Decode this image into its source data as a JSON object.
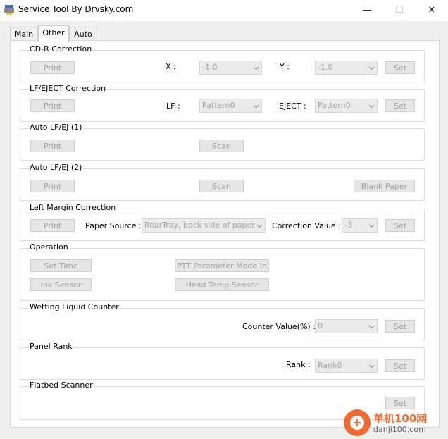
{
  "window": {
    "title": "Service Tool By Drvsky.com",
    "minimize_glyph": "—",
    "maximize_glyph": "☐",
    "close_glyph": "✕"
  },
  "tabs": [
    {
      "label": "Main",
      "active": false
    },
    {
      "label": "Other",
      "active": true
    },
    {
      "label": "Auto",
      "active": false
    }
  ],
  "cdr": {
    "title": "CD-R Correction",
    "print": "Print",
    "x_label": "X :",
    "x_value": "-1.0",
    "y_label": "Y :",
    "y_value": "-1.0",
    "set": "Set"
  },
  "lfeject": {
    "title": "LF/EJECT Correction",
    "print": "Print",
    "lf_label": "LF :",
    "lf_value": "Pattern0",
    "eject_label": "EJECT :",
    "eject_value": "Pattern0",
    "set": "Set"
  },
  "autolf1": {
    "title": "Auto LF/EJ (1)",
    "print": "Print",
    "scan": "Scan"
  },
  "autolf2": {
    "title": "Auto LF/EJ (2)",
    "print": "Print",
    "scan": "Scan",
    "blank": "Blank Paper"
  },
  "leftmargin": {
    "title": "Left Margin Correction",
    "print": "Print",
    "source_label": "Paper Source :",
    "source_value": "RearTray, back side of paper",
    "corr_label": "Correction Value :",
    "corr_value": "-3",
    "set": "Set"
  },
  "operation": {
    "title": "Operation",
    "set_time": "Set Time",
    "ptt": "PTT Parameter Mode In",
    "ink": "Ink Sensor",
    "headtemp": "Head Temp Sensor"
  },
  "wetting": {
    "title": "Wetting Liquid Counter",
    "counter_label": "Counter Value(%) :",
    "counter_value": "0",
    "set": "Set"
  },
  "panelrank": {
    "title": "Panel Rank",
    "rank_label": "Rank :",
    "rank_value": "Rank0",
    "set": "Set"
  },
  "flatbed": {
    "title": "Flatbed Scanner",
    "set": "Set"
  },
  "watermark": {
    "line1": "单机100网",
    "line2": "danji100.com",
    "glyph": "+"
  },
  "colors": {
    "disabled_text": "#a0a0a0",
    "watermark": "#f26a2e"
  }
}
